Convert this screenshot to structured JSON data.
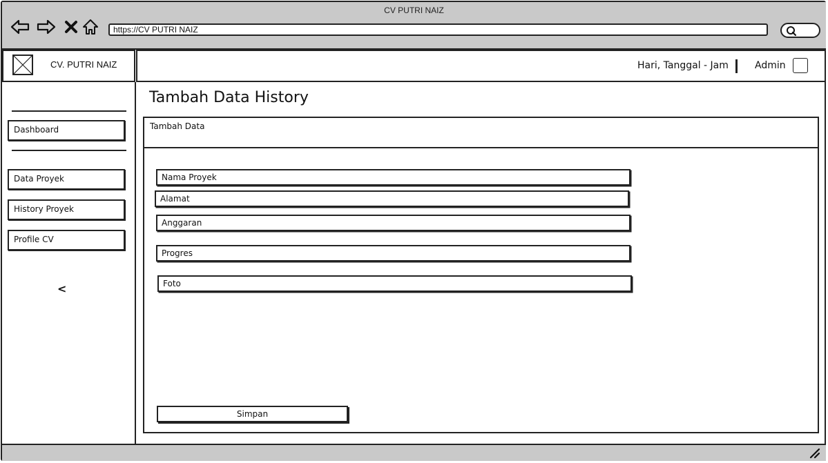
{
  "window": {
    "title": "CV PUTRI NAIZ"
  },
  "browser": {
    "url": "https://CV PUTRI NAIZ",
    "icons": [
      "back-icon",
      "forward-icon",
      "stop-icon",
      "home-icon",
      "search-icon"
    ]
  },
  "brand": {
    "name": "CV. PUTRI NAIZ",
    "logo_icon": "image-placeholder-icon"
  },
  "header": {
    "datetime": "Hari, Tanggal - Jam",
    "user": "Admin"
  },
  "sidebar": {
    "items": [
      {
        "label": "Dashboard"
      },
      {
        "label": "Data Proyek"
      },
      {
        "label": "History Proyek"
      },
      {
        "label": "Profile CV"
      }
    ],
    "collapse_glyph": "<"
  },
  "main": {
    "title": "Tambah Data History",
    "panel_title": "Tambah Data",
    "fields": [
      {
        "placeholder": "Nama Proyek",
        "value": ""
      },
      {
        "placeholder": "Alamat",
        "value": ""
      },
      {
        "placeholder": "Anggaran",
        "value": ""
      },
      {
        "placeholder": "Progres",
        "value": ""
      },
      {
        "placeholder": "Foto",
        "value": ""
      }
    ],
    "submit_label": "Simpan"
  },
  "colors": {
    "chrome": "#c9c9c9",
    "border": "#222222",
    "background": "#ffffff"
  }
}
